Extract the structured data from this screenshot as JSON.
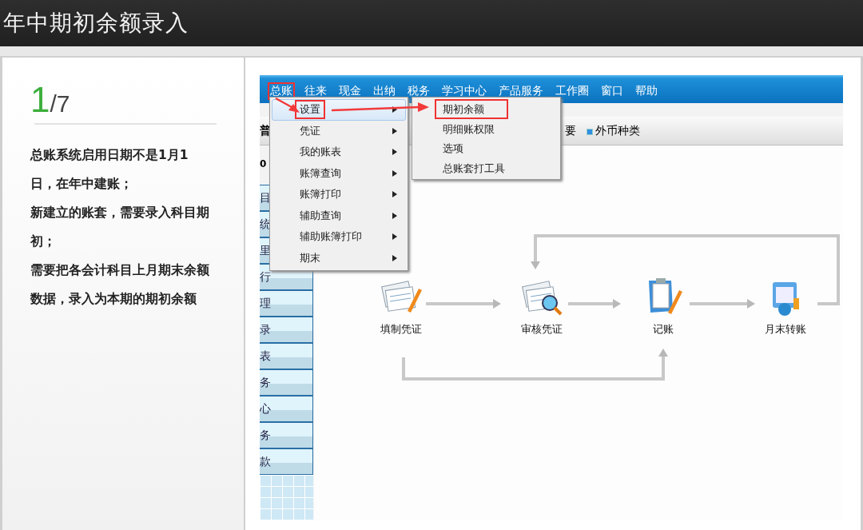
{
  "header": {
    "title": "年中期初余额录入"
  },
  "step": {
    "current": "1",
    "total": "/7"
  },
  "paragraphs": [
    "总账系统启用日期不是1月1日，在年中建账；",
    "新建立的账套，需要录入科目期初；",
    "需要把各会计科目上月期末余额数据，录入为本期的期初余额"
  ],
  "app": {
    "menubar": [
      {
        "label": "总账",
        "highlighted": true
      },
      {
        "label": "往来",
        "highlighted": false
      },
      {
        "label": "现金",
        "highlighted": false
      },
      {
        "label": "出纳",
        "highlighted": false
      },
      {
        "label": "税务",
        "highlighted": false
      },
      {
        "label": "学习中心",
        "highlighted": false
      },
      {
        "label": "产品服务",
        "highlighted": false
      },
      {
        "label": "工作圈",
        "highlighted": false
      },
      {
        "label": "窗口",
        "highlighted": false
      },
      {
        "label": "帮助",
        "highlighted": false
      }
    ],
    "menu": [
      {
        "label": "设置",
        "selected": true,
        "highlighted": true,
        "submenu": true
      },
      {
        "label": "凭证",
        "selected": false,
        "highlighted": false,
        "submenu": true
      },
      {
        "label": "我的账表",
        "selected": false,
        "highlighted": false,
        "submenu": true
      },
      {
        "label": "账簿查询",
        "selected": false,
        "highlighted": false,
        "submenu": true
      },
      {
        "label": "账簿打印",
        "selected": false,
        "highlighted": false,
        "submenu": true
      },
      {
        "label": "辅助查询",
        "selected": false,
        "highlighted": false,
        "submenu": true
      },
      {
        "label": "辅助账簿打印",
        "selected": false,
        "highlighted": false,
        "submenu": true
      },
      {
        "label": "期末",
        "selected": false,
        "highlighted": false,
        "submenu": true
      }
    ],
    "submenu": [
      {
        "label": "期初余额",
        "highlighted": true
      },
      {
        "label": "明细账权限",
        "highlighted": false
      },
      {
        "label": "选项",
        "highlighted": false
      },
      {
        "label": "总账套打工具",
        "highlighted": false
      }
    ],
    "toolbar": [
      "普",
      "要",
      "外币种类"
    ],
    "side_label": "0",
    "sidebar": [
      "目",
      "统",
      "里",
      "行",
      "理",
      "录",
      "表",
      "务",
      "心",
      "务",
      "款"
    ],
    "flow": [
      {
        "label": "填制凭证",
        "kind": "fill"
      },
      {
        "label": "审核凭证",
        "kind": "review"
      },
      {
        "label": "记账",
        "kind": "post"
      },
      {
        "label": "月末转账",
        "kind": "transfer"
      }
    ]
  }
}
